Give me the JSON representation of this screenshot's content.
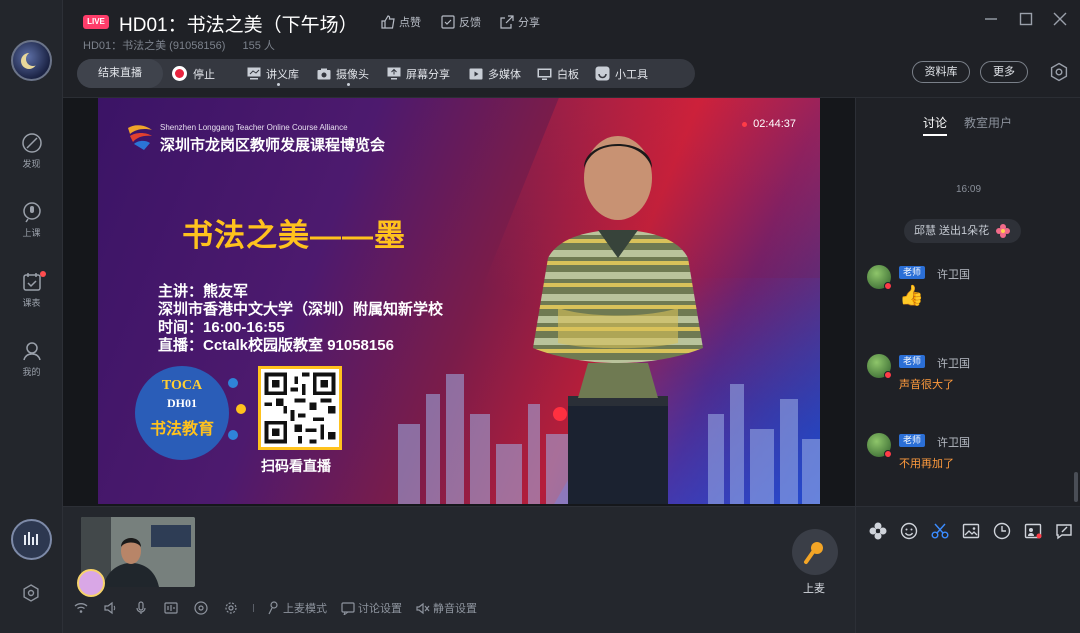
{
  "header": {
    "live_badge": "LIVE",
    "title": "HD01：书法之美（下午场）",
    "like": "点赞",
    "feedback": "反馈",
    "share": "分享",
    "room_name": "HD01：书法之美 (91058156)",
    "viewers": "155 人"
  },
  "toolbar": {
    "end_live": "结束直播",
    "stop": "停止",
    "lecture_library": "讲义库",
    "camera": "摄像头",
    "screen_share": "屏幕分享",
    "multimedia": "多媒体",
    "whiteboard": "白板",
    "tools": "小工具",
    "materials": "资料库",
    "more": "更多"
  },
  "sidebar": {
    "items": [
      {
        "label": "发现",
        "icon": "compass-icon"
      },
      {
        "label": "上课",
        "icon": "microphone-icon"
      },
      {
        "label": "课表",
        "icon": "calendar-icon"
      },
      {
        "label": "我的",
        "icon": "user-icon"
      }
    ]
  },
  "slide": {
    "alliance_en": "Shenzhen Longgang Teacher Online Course Alliance",
    "alliance_cn": "深圳市龙岗区教师发展课程博览会",
    "timer": "02:44:37",
    "course_title": "书法之美——墨",
    "lecturer": "主讲：熊友军",
    "school": "深圳市香港中文大学（深圳）附属知新学校",
    "time": "时间：16:00-16:55",
    "broadcast": "直播：Cctalk校园版教室  91058156",
    "badge_l1": "TOCA",
    "badge_l2": "DH01",
    "badge_l3": "书法教育",
    "scan_text": "扫码看直播"
  },
  "bottom": {
    "mic_label": "上麦",
    "mic_mode": "上麦模式",
    "discussion_settings": "讨论设置",
    "mute_settings": "静音设置"
  },
  "chat": {
    "tab_discussion": "讨论",
    "tab_users": "教室用户",
    "time": "16:09",
    "gift_text": "邱慧 送出1朵花",
    "messages": [
      {
        "role": "老师",
        "name": "许卫国",
        "text": "👍"
      },
      {
        "role": "老师",
        "name": "许卫国",
        "text": "声音很大了"
      },
      {
        "role": "老师",
        "name": "许卫国",
        "text": "不用再加了"
      }
    ]
  },
  "colors": {
    "live_badge": "#ff3d6a",
    "accent_blue": "#2b6fd6",
    "chat_text": "#ff9b3d",
    "slide_title": "#ffc21d"
  }
}
